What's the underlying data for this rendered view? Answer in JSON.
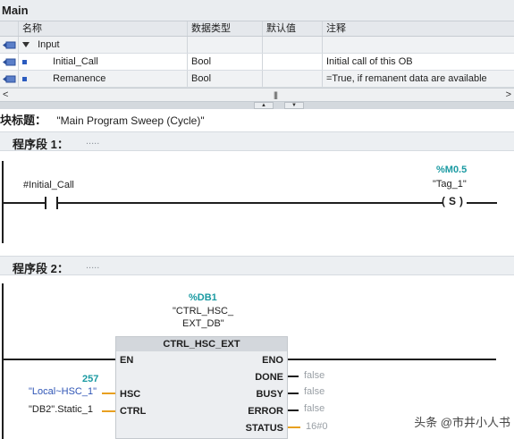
{
  "title": "Main",
  "interface_table": {
    "headers": {
      "name": "名称",
      "type": "数据类型",
      "default": "默认值",
      "comment": "注释"
    },
    "rows": [
      {
        "name": "Input",
        "type": "",
        "default": "",
        "comment": ""
      },
      {
        "name": "Initial_Call",
        "type": "Bool",
        "default": "",
        "comment": "Initial call of this OB"
      },
      {
        "name": "Remanence",
        "type": "Bool",
        "default": "",
        "comment": "=True, if remanent data are available"
      }
    ]
  },
  "scrollbar": {
    "left_arrow": "<",
    "right_arrow": ">",
    "grip": "|||"
  },
  "splitter": {
    "up": "▲",
    "down": "▼"
  },
  "block_title": {
    "label": "块标题：",
    "value": "\"Main Program Sweep (Cycle)\""
  },
  "network1": {
    "label": "程序段 1：",
    "comment": ".....",
    "contact_operand": "#Initial_Call",
    "coil_address": "%M0.5",
    "coil_tag": "\"Tag_1\"",
    "coil_symbol": "S"
  },
  "network2": {
    "label": "程序段 2：",
    "comment": ".....",
    "instance_address": "%DB1",
    "instance_name_line1": "\"CTRL_HSC_",
    "instance_name_line2": "EXT_DB\"",
    "block_name": "CTRL_HSC_EXT",
    "pins_left": {
      "en": "EN",
      "hsc": "HSC",
      "ctrl": "CTRL"
    },
    "pins_right": {
      "eno": "ENO",
      "done": "DONE",
      "busy": "BUSY",
      "error": "ERROR",
      "status": "STATUS"
    },
    "hsc_value": "257",
    "hsc_operand": "\"Local~HSC_1\"",
    "ctrl_operand": "\"DB2\".Static_1",
    "done_value": "false",
    "busy_value": "false",
    "error_value": "false",
    "status_value": "16#0"
  },
  "watermark": "头条 @市井小人书"
}
